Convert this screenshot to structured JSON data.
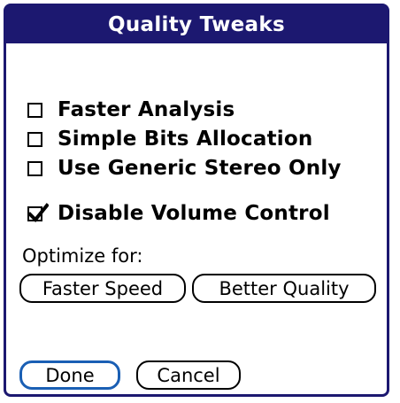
{
  "dialog": {
    "title": "Quality Tweaks"
  },
  "options": [
    {
      "label": "Faster Analysis",
      "checked": false
    },
    {
      "label": "Simple Bits Allocation",
      "checked": false
    },
    {
      "label": "Use Generic Stereo Only",
      "checked": false
    },
    {
      "label": "Disable Volume Control",
      "checked": true
    }
  ],
  "optimize": {
    "label": "Optimize for:",
    "faster_speed": "Faster Speed",
    "better_quality": "Better Quality"
  },
  "buttons": {
    "done": "Done",
    "cancel": "Cancel"
  },
  "colors": {
    "title_bar": "#1c1870",
    "title_text": "#ffffff",
    "focus_ring": "#1a5fb4"
  }
}
